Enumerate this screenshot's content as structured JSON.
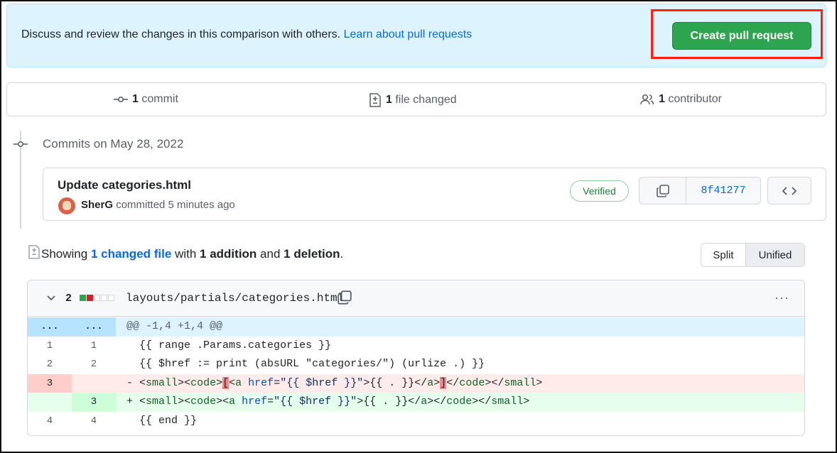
{
  "banner": {
    "text": "Discuss and review the changes in this comparison with others.",
    "link": "Learn about pull requests",
    "create_button": "Create pull request"
  },
  "stats": {
    "commits_count": "1",
    "commits_label": "commit",
    "files_count": "1",
    "files_label": "file changed",
    "contributors_count": "1",
    "contributors_label": "contributor"
  },
  "commits": {
    "date_heading": "Commits on May 28, 2022",
    "title": "Update categories.html",
    "author": "SherG",
    "meta": "committed 5 minutes ago",
    "verified": "Verified",
    "sha": "8f41277"
  },
  "summary": {
    "showing": "Showing",
    "changed_link": "1 changed file",
    "with": "with",
    "additions": "1 addition",
    "and": "and",
    "deletions": "1 deletion",
    "end": ".",
    "split": "Split",
    "unified": "Unified"
  },
  "diff": {
    "count": "2",
    "file_path": "layouts/partials/categories.html",
    "menu": "···",
    "hunk_ln": "...",
    "hunk": "@@ -1,4 +1,4 @@",
    "lines": [
      {
        "old": "1",
        "new": "1",
        "prefix": " ",
        "code": "{{ range .Params.categories }}"
      },
      {
        "old": "2",
        "new": "2",
        "prefix": " ",
        "code": "{{ $href := print (absURL \"categories/\") (urlize .) }}"
      },
      {
        "old": "3",
        "new": "",
        "prefix": "-",
        "code": "<small><code>[<a href=\"{{ $href }}\">{{ . }}</a>]</code></small>"
      },
      {
        "old": "",
        "new": "3",
        "prefix": "+",
        "code": "<small><code><a href=\"{{ $href }}\">{{ . }}</a></code></small>"
      },
      {
        "old": "4",
        "new": "4",
        "prefix": " ",
        "code": "{{ end }}"
      }
    ]
  }
}
